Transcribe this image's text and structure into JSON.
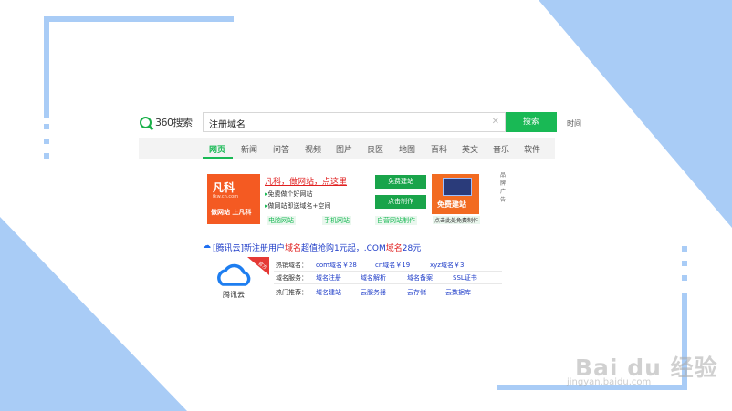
{
  "logo": {
    "text": "360搜索",
    "brand_color": "#19b955"
  },
  "search": {
    "query": "注册域名",
    "button": "搜索",
    "clear_icon": "close-icon"
  },
  "time_link": "时间",
  "nav": {
    "tabs": [
      "网页",
      "新闻",
      "问答",
      "视频",
      "图片",
      "良医",
      "地图",
      "百科",
      "英文",
      "音乐",
      "软件"
    ],
    "active": "网页"
  },
  "ad": {
    "left_image": {
      "brand": "凡科",
      "site": "fkw.cn.com",
      "slogan": "做网站 上凡科"
    },
    "title": "凡科，做网站，点这里",
    "items": [
      "免费做个好网站",
      "做网站即送域名+空间"
    ],
    "green_links": [
      "电脑网站",
      "手机网站",
      "自营网站制作"
    ],
    "buttons": [
      "免费建站",
      "点击制作",
      "点击制作"
    ],
    "right_image": {
      "label": "免费建站"
    },
    "right_caption": "点击此处免费制作",
    "side_label": "品牌广告"
  },
  "result": {
    "title_prefix": "[腾讯云]新注册用户",
    "title_red1": "域名",
    "title_mid": "超值抢购1元起，.COM",
    "title_red2": "域名",
    "title_suffix": "28元",
    "brand": "腾讯云",
    "corner_badge": "官方",
    "rows": [
      {
        "label": "热销域名：",
        "links": [
          "com域名￥28",
          "cn域名￥19",
          "xyz域名￥3"
        ]
      },
      {
        "label": "域名服务：",
        "links": [
          "域名注册",
          "域名解析",
          "域名备案",
          "SSL证书"
        ]
      },
      {
        "label": "热门推荐：",
        "links": [
          "域名建站",
          "云服务器",
          "云存储",
          "云数据库"
        ]
      }
    ]
  },
  "watermark": {
    "main": "Bai du 经验",
    "sub": "jingyan.baidu.com"
  },
  "colors": {
    "frame": "#a9ccf6",
    "accent_green": "#19b955",
    "link_blue": "#1e3cc8",
    "ad_red": "#e02020"
  }
}
